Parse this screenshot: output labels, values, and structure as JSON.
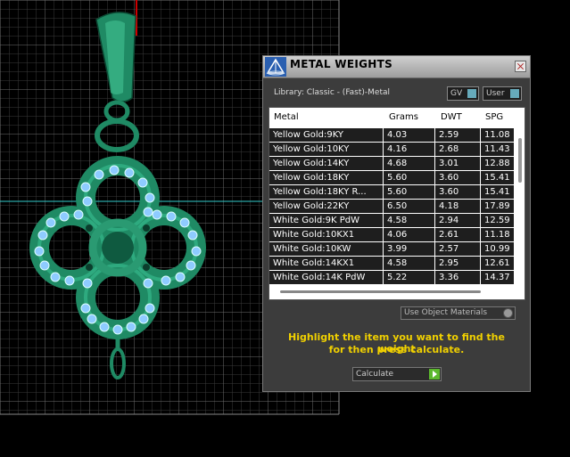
{
  "panel": {
    "title": "METAL WEIGHTS",
    "library_label": "Library: Classic - (Fast)-Metal",
    "gv_label": "GV",
    "user_label": "User",
    "use_object_materials": "Use Object Materials",
    "instructions_line1": "Highlight the item you want to find the weight",
    "instructions_line2": "for then press calculate.",
    "calculate_label": "Calculate"
  },
  "table": {
    "headers": [
      "Metal",
      "Grams",
      "DWT",
      "SPG"
    ],
    "rows": [
      [
        "Yellow Gold:9KY",
        "4.03",
        "2.59",
        "11.08"
      ],
      [
        "Yellow Gold:10KY",
        "4.16",
        "2.68",
        "11.43"
      ],
      [
        "Yellow Gold:14KY",
        "4.68",
        "3.01",
        "12.88"
      ],
      [
        "Yellow Gold:18KY",
        "5.60",
        "3.60",
        "15.41"
      ],
      [
        "Yellow Gold:18KY R...",
        "5.60",
        "3.60",
        "15.41"
      ],
      [
        "Yellow Gold:22KY",
        "6.50",
        "4.18",
        "17.89"
      ],
      [
        "White Gold:9K PdW",
        "4.58",
        "2.94",
        "12.59"
      ],
      [
        "White Gold:10KX1",
        "4.06",
        "2.61",
        "11.18"
      ],
      [
        "White Gold:10KW",
        "3.99",
        "2.57",
        "10.99"
      ],
      [
        "White Gold:14KX1",
        "4.58",
        "2.95",
        "12.61"
      ],
      [
        "White Gold:14K PdW",
        "5.22",
        "3.36",
        "14.37"
      ]
    ]
  },
  "icons": {
    "title": "pyramid-icon",
    "close": "close-icon",
    "calculate": "play-arrow-icon",
    "dropdown": "radio-knob-icon"
  },
  "colors": {
    "pendant": "#2fa37a",
    "gem": "#8ecbff",
    "instruction_text": "#f0d000",
    "calculate_button": "#5cb82d"
  }
}
